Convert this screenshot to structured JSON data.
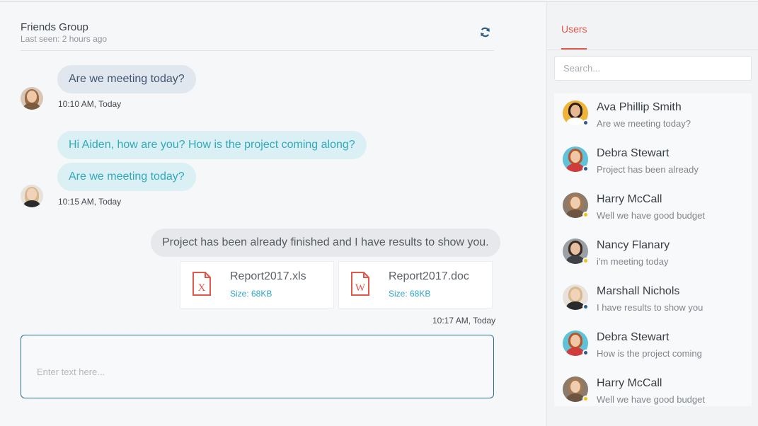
{
  "chat": {
    "title": "Friends Group",
    "last_seen": "Last seen: 2 hours ago",
    "refresh_icon": "refresh-icon",
    "messages": [
      {
        "text": "Are we meeting today?",
        "time": "10:10 AM, Today"
      },
      {
        "text": "Hi Aiden, how are you? How is the project coming along?"
      },
      {
        "text": "Are we meeting today?",
        "time": "10:15 AM, Today"
      },
      {
        "text": "Project has been already finished and I have results to show you.",
        "time": "10:17 AM, Today"
      }
    ],
    "files": [
      {
        "name": "Report2017.xls",
        "size": "Size: 68KB",
        "icon": "excel-file-icon"
      },
      {
        "name": "Report2017.doc",
        "size": "Size: 68KB",
        "icon": "word-file-icon"
      }
    ],
    "compose_placeholder": "Enter text here..."
  },
  "users_panel": {
    "tab_label": "Users",
    "search_placeholder": "Search...",
    "users": [
      {
        "name": "Ava Phillip Smith",
        "message": "Are we meeting today?",
        "status": "online"
      },
      {
        "name": "Debra Stewart",
        "message": "Project has been already",
        "status": "online"
      },
      {
        "name": "Harry McCall",
        "message": "Well we have good budget",
        "status": "away"
      },
      {
        "name": "Nancy Flanary",
        "message": "i'm meeting today",
        "status": "away"
      },
      {
        "name": "Marshall Nichols",
        "message": "I have results to show you",
        "status": "online"
      },
      {
        "name": "Debra Stewart",
        "message": "How is the project coming",
        "status": "online"
      },
      {
        "name": "Harry McCall",
        "message": "Well we have good budget",
        "status": "away"
      }
    ]
  },
  "colors": {
    "accent": "#e2574c",
    "online": "#2e5c8a",
    "away": "#f1c40f",
    "link": "#2ea3c4"
  }
}
